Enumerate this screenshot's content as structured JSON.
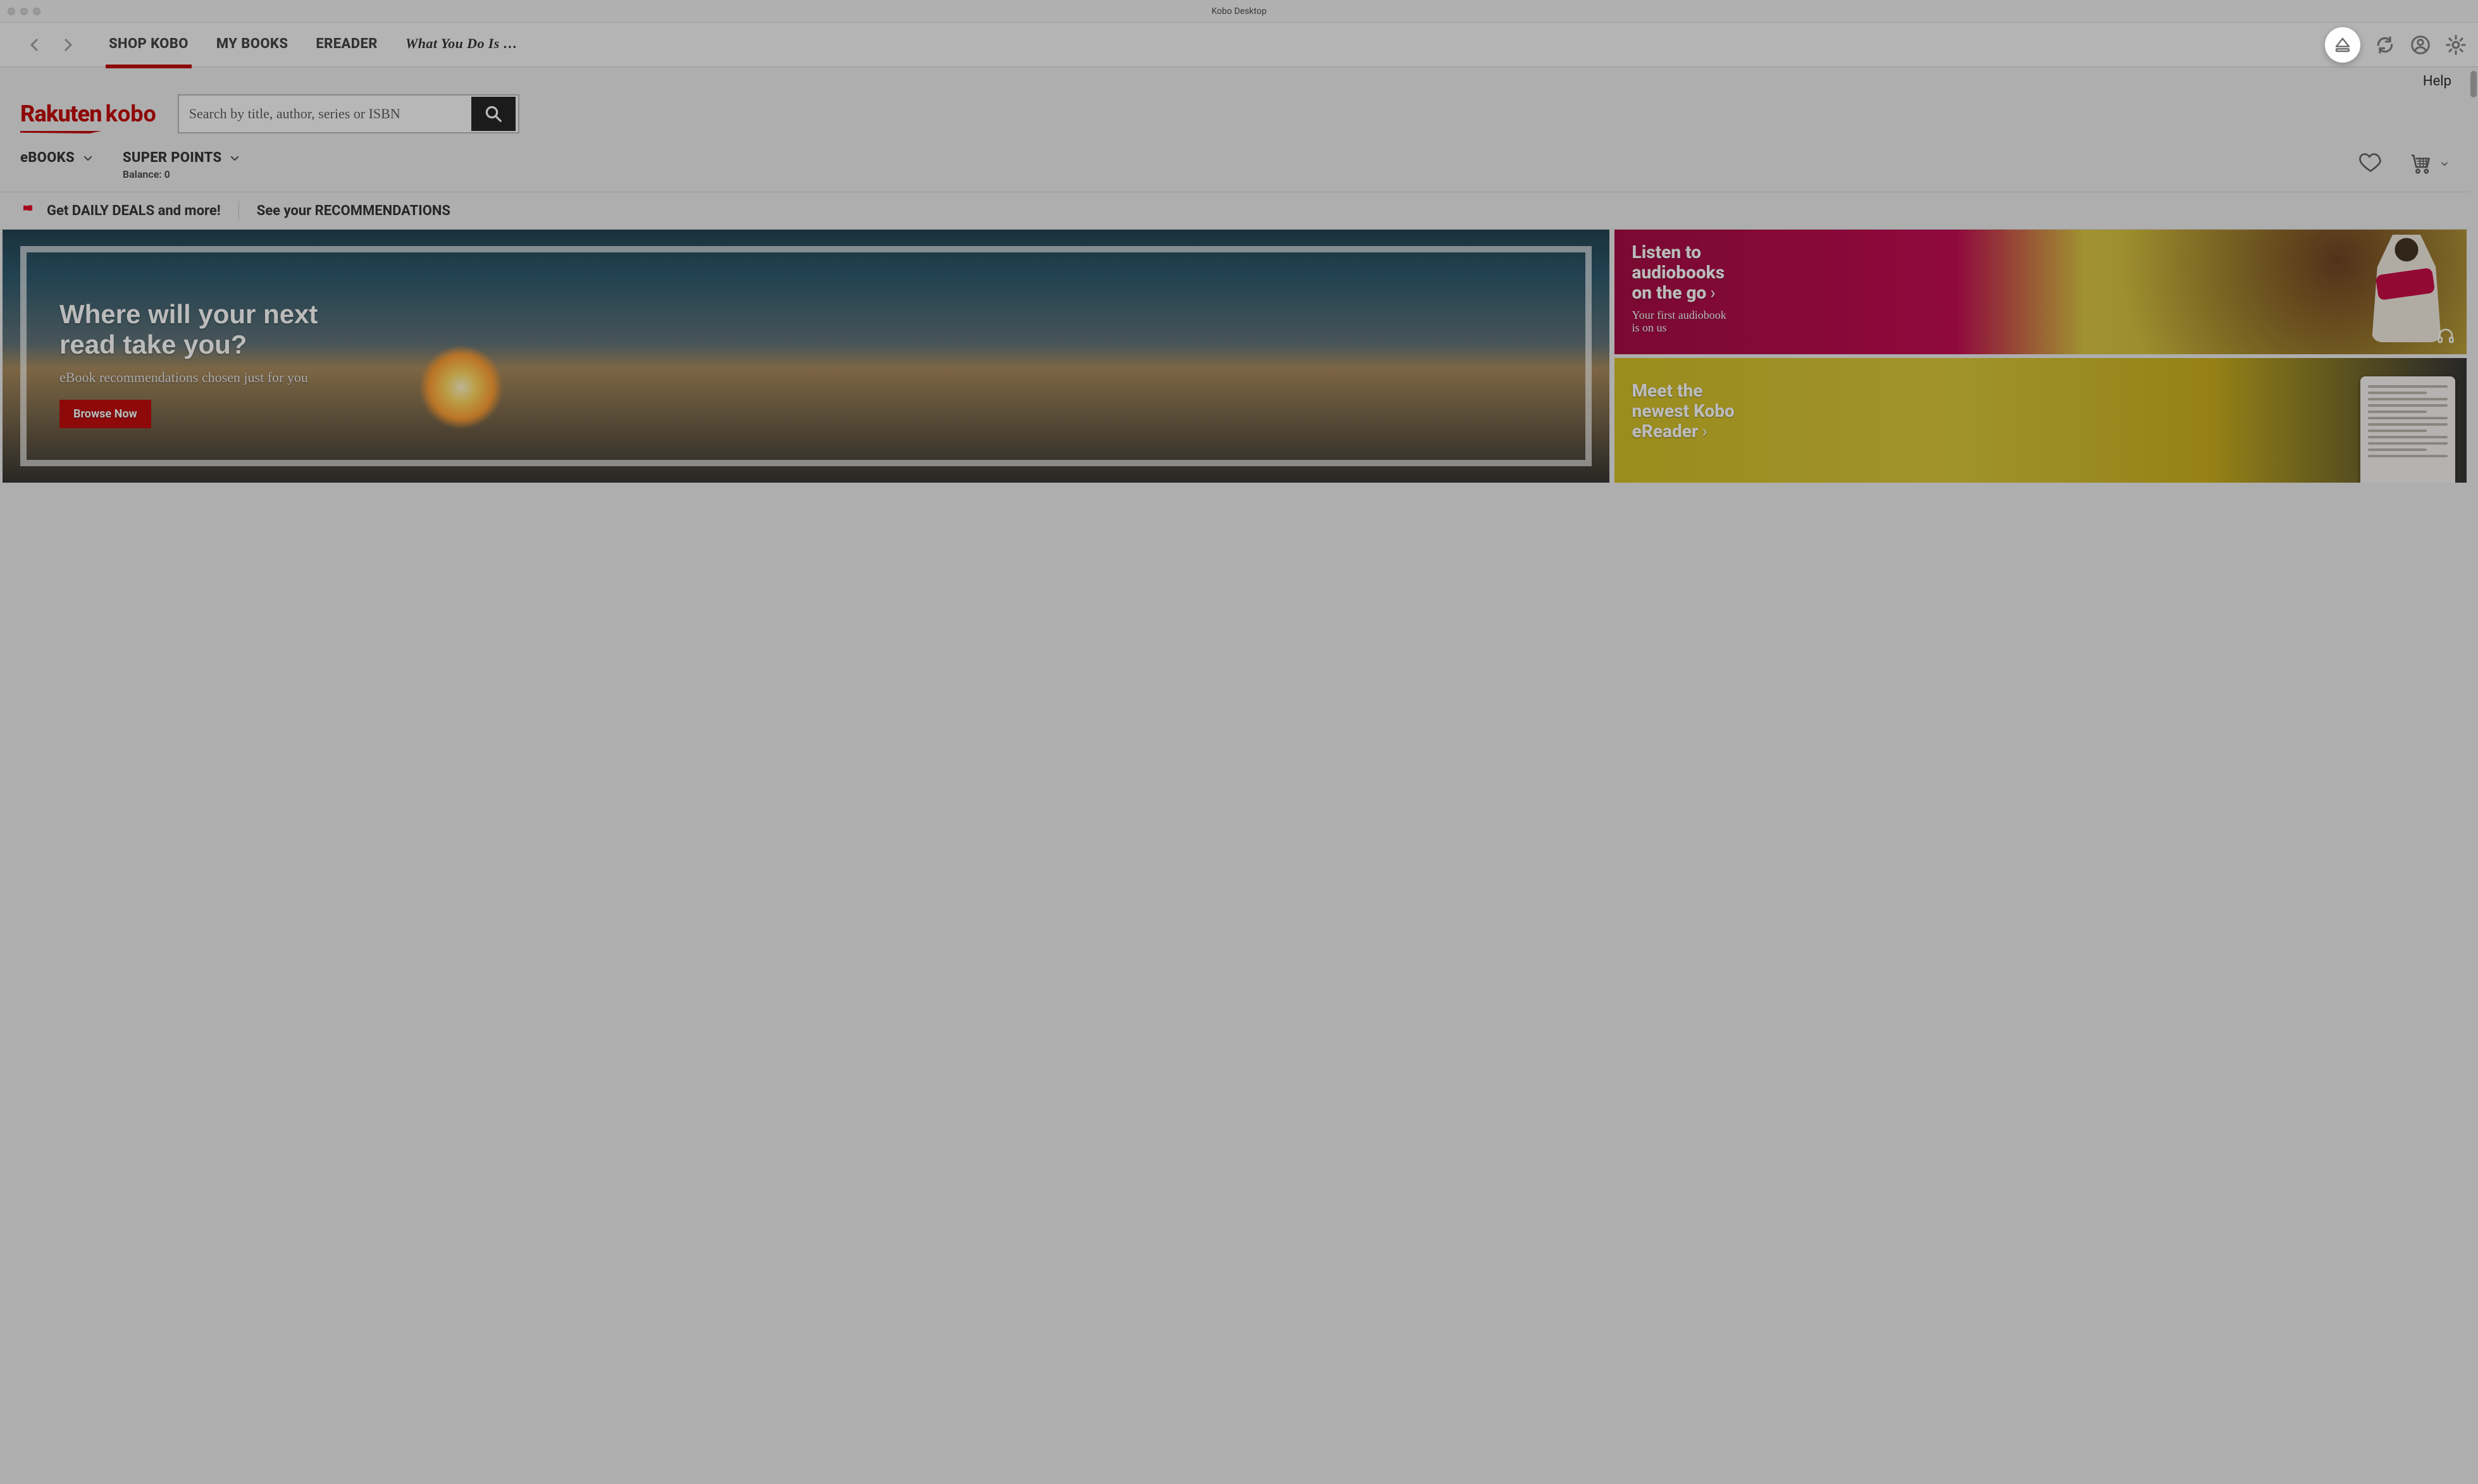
{
  "window": {
    "title": "Kobo Desktop"
  },
  "nav": {
    "tabs": [
      {
        "label": "SHOP KOBO",
        "active": true
      },
      {
        "label": "MY BOOKS"
      },
      {
        "label": "EREADER"
      },
      {
        "label": "What You Do Is …",
        "italic": true
      }
    ],
    "icons": {
      "eject": "eject-icon",
      "sync": "sync-icon",
      "profile": "profile-icon",
      "settings": "gear-icon"
    }
  },
  "help": {
    "label": "Help"
  },
  "brand": {
    "rakuten": "Rakuten",
    "kobo": "kobo"
  },
  "search": {
    "placeholder": "Search by title, author, series or ISBN"
  },
  "secondary": {
    "ebooks_label": "eBOOKS",
    "points_label": "SUPER POINTS",
    "balance_label": "Balance: 0"
  },
  "promo": {
    "deals": "Get DAILY DEALS and more!",
    "recs": "See your RECOMMENDATIONS"
  },
  "banners": {
    "main": {
      "title_l1": "Where will your next",
      "title_l2": "read take you?",
      "subtitle": "eBook recommendations chosen just for you",
      "button": "Browse Now"
    },
    "audio": {
      "line1": "Listen to",
      "line2": "audiobooks",
      "line3": "on the go",
      "sub1": "Your first audiobook",
      "sub2": "is on us"
    },
    "ereader": {
      "line1": "Meet the",
      "line2": "newest Kobo",
      "line3": "eReader"
    }
  },
  "colors": {
    "brand_red": "#bf0000"
  }
}
